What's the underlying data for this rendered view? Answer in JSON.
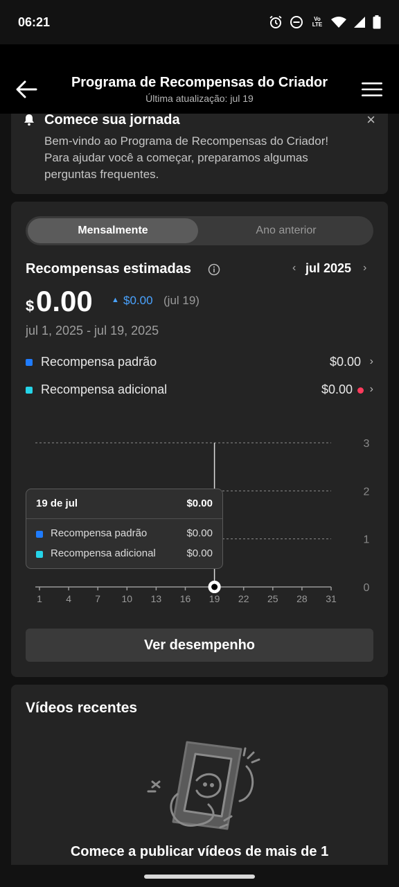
{
  "status": {
    "time": "06:21",
    "icons": [
      "alarm-icon",
      "do-not-disturb-icon",
      "volte-icon",
      "wifi-icon",
      "signal-icon",
      "battery-icon"
    ],
    "volte_label": "Vo LTE"
  },
  "header": {
    "title": "Programa de Recompensas do Criador",
    "subtitle": "Última atualização: jul 19"
  },
  "journey": {
    "title": "Comece sua jornada",
    "close": "×",
    "text": "Bem-vindo ao Programa de Recompensas do Criador! Para ajudar você a começar, preparamos algumas perguntas frequentes."
  },
  "rewards": {
    "tabs": [
      "Mensalmente",
      "Ano anterior"
    ],
    "active_tab": "Mensalmente",
    "title": "Recompensas estimadas",
    "month_prev": "‹",
    "month": "jul 2025",
    "month_next": "›",
    "currency": "$",
    "amount": "0.00",
    "delta_arrow": "▲",
    "delta": "$0.00",
    "delta_date": "(jul 19)",
    "date_range": "jul 1, 2025 - jul 19, 2025",
    "breakdown": [
      {
        "label": "Recompensa padrão",
        "value": "$0.00",
        "chevron": "›",
        "color": "#1f7cff"
      },
      {
        "label": "Recompensa adicional",
        "value": "$0.00",
        "chevron": "›",
        "color": "#25d4e8",
        "alert": true
      }
    ],
    "performance_button": "Ver desempenho"
  },
  "tooltip": {
    "date": "19 de jul",
    "total": "$0.00",
    "rows": [
      {
        "label": "Recompensa padrão",
        "value": "$0.00",
        "color": "#1f7cff"
      },
      {
        "label": "Recompensa adicional",
        "value": "$0.00",
        "color": "#25d4e8"
      }
    ]
  },
  "chart_data": {
    "type": "line",
    "x": [
      1,
      4,
      7,
      10,
      13,
      16,
      19,
      22,
      25,
      28,
      31
    ],
    "x_tick_labels": [
      "1",
      "4",
      "7",
      "10",
      "13",
      "16",
      "19",
      "22",
      "25",
      "28",
      "31"
    ],
    "y_tick_labels": [
      "3",
      "2",
      "1",
      "0"
    ],
    "ylim": [
      0,
      3
    ],
    "xlim": [
      1,
      31
    ],
    "series": [
      {
        "name": "Recompensa padrão",
        "points": [
          [
            19,
            0
          ]
        ]
      },
      {
        "name": "Recompensa adicional",
        "points": [
          [
            19,
            0
          ]
        ]
      }
    ],
    "highlight_x": 19,
    "grid": true
  },
  "videos": {
    "title": "Vídeos recentes",
    "empty_text": "Comece a publicar vídeos de mais de 1"
  }
}
